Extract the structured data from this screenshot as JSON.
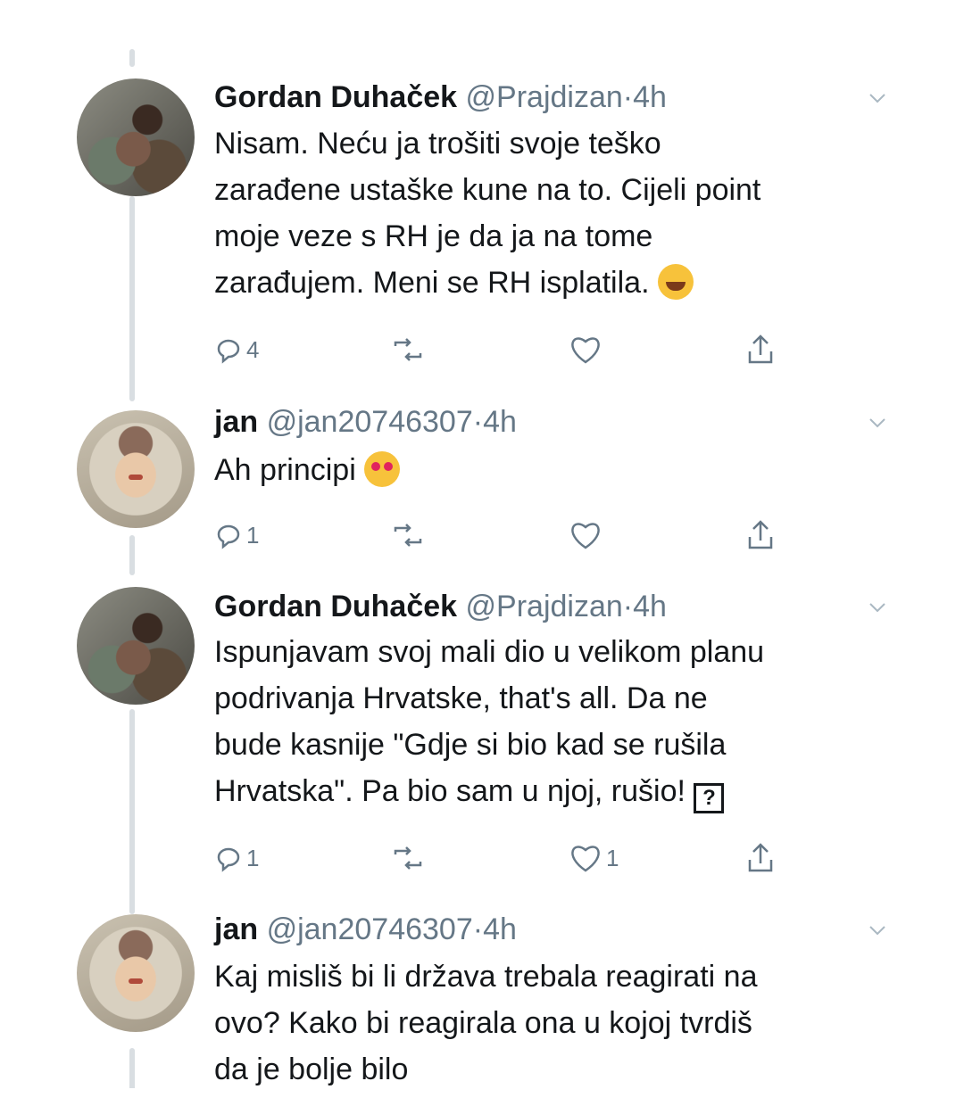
{
  "tweets": [
    {
      "name": "Gordan Duhaček",
      "handle": "@Prajdizan",
      "dot": "·",
      "time": "4h",
      "avatar": "gordan-avatar",
      "text_lines": [
        "Nisam. Neću ja trošiti svoje teško",
        "zarađene ustaške kune na to. Cijeli point",
        "moje veze s RH je da ja na tome",
        "zarađujem. Meni se RH isplatila."
      ],
      "emoji": "face-with-tears-of-joy",
      "replies": "4",
      "likes": ""
    },
    {
      "name": "jan",
      "handle": "@jan20746307",
      "dot": "·",
      "time": "4h",
      "avatar": "jan-avatar",
      "text_lines": [
        "Ah principi"
      ],
      "emoji": "smiling-face-with-heart-eyes",
      "replies": "1",
      "likes": ""
    },
    {
      "name": "Gordan Duhaček",
      "handle": "@Prajdizan",
      "dot": "·",
      "time": "4h",
      "avatar": "gordan-avatar",
      "text_lines": [
        "Ispunjavam svoj mali dio u velikom planu",
        "podrivanja Hrvatske, that's all. Da ne",
        "bude kasnije \"Gdje si bio kad se rušila",
        "Hrvatska\". Pa bio sam u njoj, rušio!"
      ],
      "emoji": "unknown-glyph-box",
      "emoji_text": "?",
      "replies": "1",
      "likes": "1"
    },
    {
      "name": "jan",
      "handle": "@jan20746307",
      "dot": "·",
      "time": "4h",
      "avatar": "jan-avatar",
      "text_lines": [
        "Kaj misliš bi li država trebala reagirati na",
        "ovo? Kako bi reagirala ona u kojoj tvrdiš",
        "da je bolje bilo"
      ]
    }
  ],
  "icons": [
    "reply-icon",
    "retweet-icon",
    "like-icon",
    "share-icon",
    "chevron-down-icon"
  ],
  "colors": {
    "text": "#14171a",
    "secondary": "#657786",
    "thread": "#d9dee2"
  }
}
